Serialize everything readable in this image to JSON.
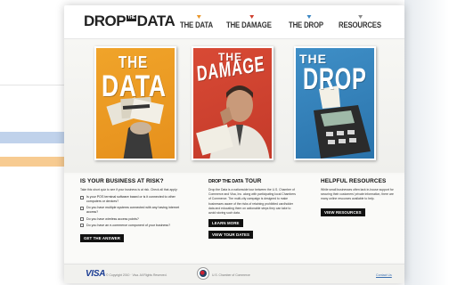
{
  "brand": {
    "logo_part1": "DROP",
    "logo_the": "THE",
    "logo_part2": "DATA"
  },
  "nav": [
    {
      "label": "THE DATA",
      "color": "#e9962a"
    },
    {
      "label": "THE DAMAGE",
      "color": "#cf3f2e"
    },
    {
      "label": "THE DROP",
      "color": "#3a86c2"
    },
    {
      "label": "RESOURCES",
      "color": "#888888"
    }
  ],
  "posters": {
    "data": {
      "the": "THE",
      "main": "DATA"
    },
    "damage": {
      "the": "THE",
      "main": "DAMAGE"
    },
    "drop": {
      "the": "THE",
      "main": "DROP"
    }
  },
  "risk": {
    "heading": "IS YOUR BUSINESS AT RISK?",
    "intro": "Take this short quiz to see if your business is at risk. Check all that apply:",
    "questions": [
      "Is your POS terminal software based or is it connected to other computers or devices?",
      "Do you have multiple systems connected with any having internet access?",
      "Do you have wireless access points?",
      "Do you have an e-commerce component of your business?"
    ],
    "button": "GET THE ANSWER"
  },
  "tour": {
    "heading_logo": "DROP THE DATA",
    "heading_word": "TOUR",
    "body": "Drop the Data is a nationwide tour between the U.S. Chamber of Commerce and Visa, Inc. along with participating local Chambers of Commerce. The multi-city campaign is designed to make businesses aware of the risks of retaining prohibited cardholder data and educating them on actionable steps they can take to avoid storing such data.",
    "button_learn": "LEARN MORE",
    "button_dates": "VIEW TOUR DATES"
  },
  "resources": {
    "heading": "HELPFUL RESOURCES",
    "body": "While small businesses often lack in-house support for securing their customers' private information, there are many online resources available to help.",
    "button": "VIEW RESOURCES"
  },
  "footer": {
    "visa": "VISA",
    "copyright": "© Copyright 2010 · Visa. All Rights Reserved.",
    "chamber": "U.S. Chamber of Commerce",
    "contact": "Contact Us"
  }
}
